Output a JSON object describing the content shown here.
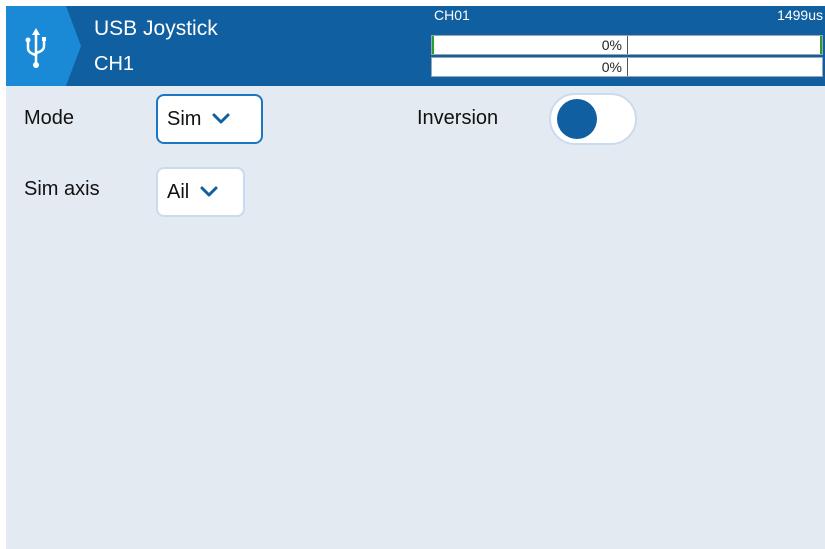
{
  "header": {
    "title": "USB Joystick",
    "subtitle": "CH1",
    "icon": "usb-icon",
    "channel": {
      "label": "CH01",
      "value": "1499us",
      "bars": [
        {
          "percent_label": "0%",
          "level": 0
        },
        {
          "percent_label": "0%",
          "level": 0
        }
      ]
    }
  },
  "form": {
    "mode": {
      "label": "Mode",
      "value": "Sim"
    },
    "sim_axis": {
      "label": "Sim axis",
      "value": "Ail"
    },
    "inversion": {
      "label": "Inversion",
      "enabled": false
    }
  },
  "colors": {
    "header_bg": "#105fa0",
    "accent": "#1b76c3",
    "background": "#e3eaf1",
    "bar_edge": "#2a9d2a"
  }
}
